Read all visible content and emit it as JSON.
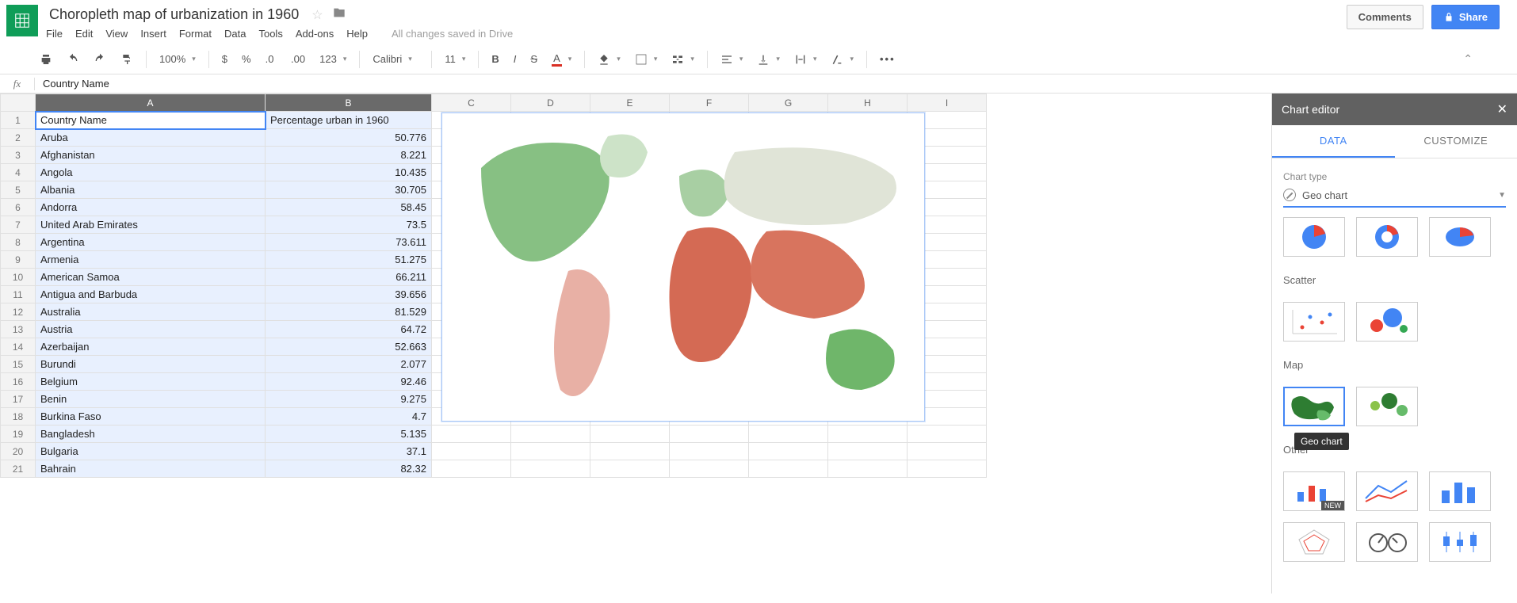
{
  "doc": {
    "title": "Choropleth map of urbanization in 1960",
    "save_status": "All changes saved in Drive"
  },
  "menu": [
    "File",
    "Edit",
    "View",
    "Insert",
    "Format",
    "Data",
    "Tools",
    "Add-ons",
    "Help"
  ],
  "buttons": {
    "comments": "Comments",
    "share": "Share"
  },
  "toolbar": {
    "zoom": "100%",
    "font": "Calibri",
    "size": "11"
  },
  "fx": {
    "label": "fx",
    "value": "Country Name"
  },
  "columns": [
    "A",
    "B",
    "C",
    "D",
    "E",
    "F",
    "G",
    "H",
    "I"
  ],
  "headers": {
    "A": "Country Name",
    "B": "Percentage urban in 1960"
  },
  "rows": [
    {
      "n": 1,
      "a": "Country Name",
      "b": "Percentage urban in 1960",
      "hdr": true
    },
    {
      "n": 2,
      "a": "Aruba",
      "b": "50.776"
    },
    {
      "n": 3,
      "a": "Afghanistan",
      "b": "8.221"
    },
    {
      "n": 4,
      "a": "Angola",
      "b": "10.435"
    },
    {
      "n": 5,
      "a": "Albania",
      "b": "30.705"
    },
    {
      "n": 6,
      "a": "Andorra",
      "b": "58.45"
    },
    {
      "n": 7,
      "a": "United Arab Emirates",
      "b": "73.5"
    },
    {
      "n": 8,
      "a": "Argentina",
      "b": "73.611"
    },
    {
      "n": 9,
      "a": "Armenia",
      "b": "51.275"
    },
    {
      "n": 10,
      "a": "American Samoa",
      "b": "66.211"
    },
    {
      "n": 11,
      "a": "Antigua and Barbuda",
      "b": "39.656"
    },
    {
      "n": 12,
      "a": "Australia",
      "b": "81.529"
    },
    {
      "n": 13,
      "a": "Austria",
      "b": "64.72"
    },
    {
      "n": 14,
      "a": "Azerbaijan",
      "b": "52.663"
    },
    {
      "n": 15,
      "a": "Burundi",
      "b": "2.077"
    },
    {
      "n": 16,
      "a": "Belgium",
      "b": "92.46"
    },
    {
      "n": 17,
      "a": "Benin",
      "b": "9.275"
    },
    {
      "n": 18,
      "a": "Burkina Faso",
      "b": "4.7"
    },
    {
      "n": 19,
      "a": "Bangladesh",
      "b": "5.135"
    },
    {
      "n": 20,
      "a": "Bulgaria",
      "b": "37.1"
    },
    {
      "n": 21,
      "a": "Bahrain",
      "b": "82.32"
    }
  ],
  "panel": {
    "title": "Chart editor",
    "tabs": {
      "data": "DATA",
      "customize": "CUSTOMIZE"
    },
    "chart_type_label": "Chart type",
    "chart_type_value": "Geo chart",
    "cat_scatter": "Scatter",
    "cat_map": "Map",
    "cat_other": "Other",
    "tooltip": "Geo chart",
    "badge_new": "NEW"
  },
  "chart_data": {
    "type": "geo",
    "title": "",
    "region": "world",
    "color_axis": {
      "min_color": "#d9534f",
      "max_color": "#5cb85c"
    },
    "series": [
      {
        "name": "Percentage urban in 1960",
        "values": [
          {
            "c": "Aruba",
            "v": 50.776
          },
          {
            "c": "Afghanistan",
            "v": 8.221
          },
          {
            "c": "Angola",
            "v": 10.435
          },
          {
            "c": "Albania",
            "v": 30.705
          },
          {
            "c": "Andorra",
            "v": 58.45
          },
          {
            "c": "United Arab Emirates",
            "v": 73.5
          },
          {
            "c": "Argentina",
            "v": 73.611
          },
          {
            "c": "Armenia",
            "v": 51.275
          },
          {
            "c": "American Samoa",
            "v": 66.211
          },
          {
            "c": "Antigua and Barbuda",
            "v": 39.656
          },
          {
            "c": "Australia",
            "v": 81.529
          },
          {
            "c": "Austria",
            "v": 64.72
          },
          {
            "c": "Azerbaijan",
            "v": 52.663
          },
          {
            "c": "Burundi",
            "v": 2.077
          },
          {
            "c": "Belgium",
            "v": 92.46
          },
          {
            "c": "Benin",
            "v": 9.275
          },
          {
            "c": "Burkina Faso",
            "v": 4.7
          },
          {
            "c": "Bangladesh",
            "v": 5.135
          },
          {
            "c": "Bulgaria",
            "v": 37.1
          },
          {
            "c": "Bahrain",
            "v": 82.32
          }
        ]
      }
    ]
  }
}
